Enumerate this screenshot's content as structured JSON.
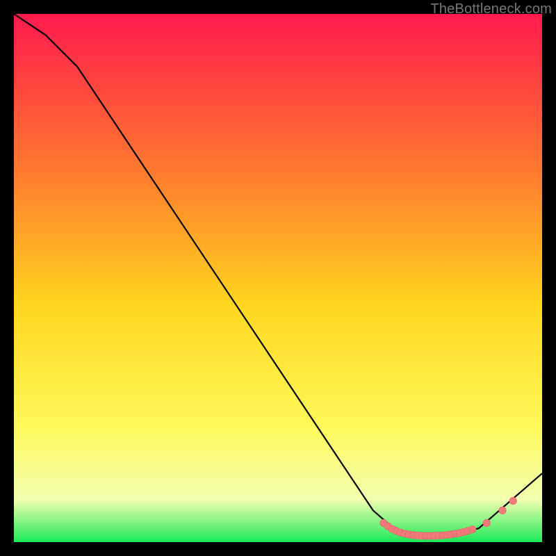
{
  "watermark": "TheBottleneck.com",
  "colors": {
    "gradient_top": "#ff1a4d",
    "gradient_mid1": "#ff7a2e",
    "gradient_mid2": "#ffd61f",
    "gradient_mid3": "#fff95a",
    "gradient_bottom_y": "#f2ffb0",
    "gradient_green": "#1bea58",
    "line": "#000000",
    "marker_fill": "#f07a7a",
    "marker_stroke": "#e46b6b"
  },
  "chart_data": {
    "type": "line",
    "title": "",
    "xlabel": "",
    "ylabel": "",
    "xlim": [
      0,
      100
    ],
    "ylim": [
      0,
      100
    ],
    "curve": [
      {
        "x": 0,
        "y": 100
      },
      {
        "x": 6,
        "y": 96
      },
      {
        "x": 12,
        "y": 90
      },
      {
        "x": 68,
        "y": 6
      },
      {
        "x": 72,
        "y": 2.5
      },
      {
        "x": 76,
        "y": 1.2
      },
      {
        "x": 82,
        "y": 1.2
      },
      {
        "x": 88,
        "y": 2.6
      },
      {
        "x": 100,
        "y": 13
      }
    ],
    "markers": [
      {
        "x": 70.0,
        "y": 3.6
      },
      {
        "x": 70.8,
        "y": 3.0
      },
      {
        "x": 71.6,
        "y": 2.5
      },
      {
        "x": 72.4,
        "y": 2.1
      },
      {
        "x": 73.2,
        "y": 1.8
      },
      {
        "x": 74.0,
        "y": 1.6
      },
      {
        "x": 74.8,
        "y": 1.45
      },
      {
        "x": 75.6,
        "y": 1.32
      },
      {
        "x": 76.4,
        "y": 1.24
      },
      {
        "x": 77.2,
        "y": 1.2
      },
      {
        "x": 78.0,
        "y": 1.18
      },
      {
        "x": 78.8,
        "y": 1.18
      },
      {
        "x": 79.6,
        "y": 1.2
      },
      {
        "x": 80.4,
        "y": 1.22
      },
      {
        "x": 81.2,
        "y": 1.28
      },
      {
        "x": 82.0,
        "y": 1.36
      },
      {
        "x": 82.8,
        "y": 1.46
      },
      {
        "x": 83.6,
        "y": 1.58
      },
      {
        "x": 84.4,
        "y": 1.74
      },
      {
        "x": 85.2,
        "y": 1.92
      },
      {
        "x": 86.0,
        "y": 2.14
      },
      {
        "x": 86.8,
        "y": 2.4
      },
      {
        "x": 89.5,
        "y": 3.6
      },
      {
        "x": 92.5,
        "y": 6.0
      },
      {
        "x": 94.5,
        "y": 7.8
      }
    ]
  }
}
